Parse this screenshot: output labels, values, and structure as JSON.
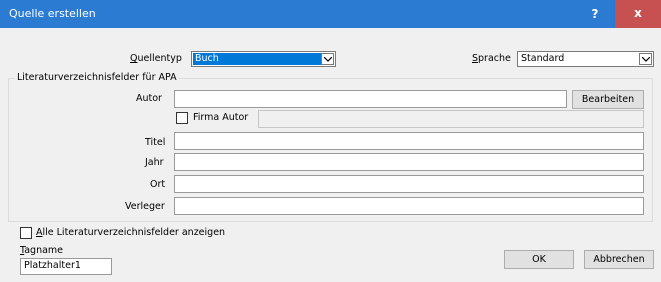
{
  "window": {
    "title": "Quelle erstellen",
    "help_label": "?",
    "close_label": "x"
  },
  "source_type": {
    "label_underlined": "Q",
    "label_rest": "uellentyp",
    "value": "Buch"
  },
  "language": {
    "label_underlined": "S",
    "label_rest": "prache",
    "value": "Standard"
  },
  "group": {
    "title": "Literaturverzeichnisfelder für APA",
    "author_label": "Autor",
    "edit_button": "Bearbeiten",
    "corporate_author_label": "Firma Autor",
    "title_label": "Titel",
    "year_label": "Jahr",
    "city_label": "Ort",
    "publisher_label": "Verleger"
  },
  "show_all": {
    "label_underlined": "A",
    "label_rest": "lle Literaturverzeichnisfelder anzeigen",
    "checked": false
  },
  "tag": {
    "label_underlined": "T",
    "label_rest": "agname",
    "value": "Platzhalter1"
  },
  "buttons": {
    "ok": "OK",
    "cancel": "Abbrechen"
  },
  "colors": {
    "titlebar": "#2b7bd2",
    "close": "#c75050",
    "selection": "#0078d7",
    "dialog_bg": "#f0f0f0"
  }
}
